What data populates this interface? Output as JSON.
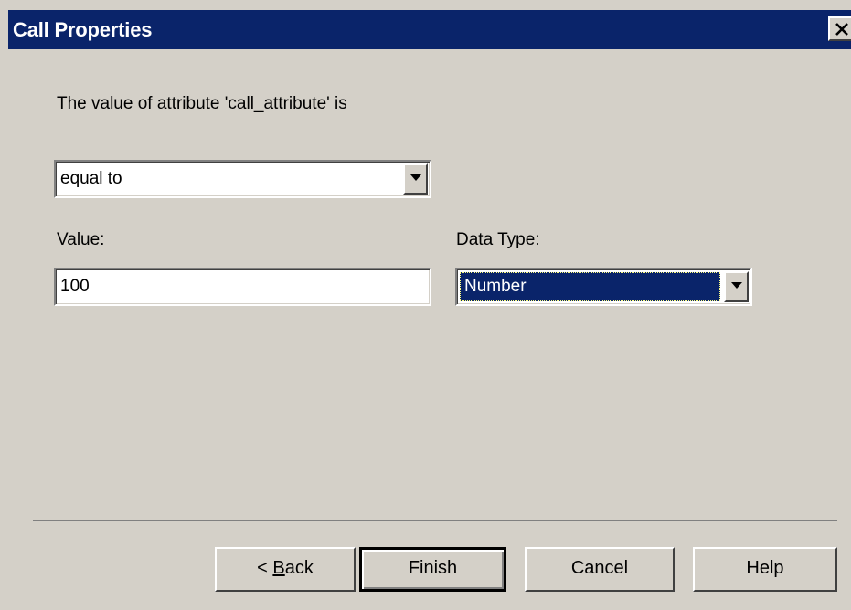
{
  "window": {
    "title": "Call Properties",
    "close_glyph": "✕"
  },
  "condition": {
    "prompt": "The value of attribute 'call_attribute' is",
    "operator_selected": "equal to"
  },
  "value_field": {
    "label": "Value:",
    "value": "100"
  },
  "data_type": {
    "label": "Data Type:",
    "selected": "Number"
  },
  "buttons": {
    "back_prefix": "< ",
    "back_accel": "B",
    "back_rest": "ack",
    "finish": "Finish",
    "cancel": "Cancel",
    "help": "Help"
  },
  "colors": {
    "face": "#d4d0c8",
    "titlebar": "#0a246a",
    "selection": "#0a246a"
  }
}
